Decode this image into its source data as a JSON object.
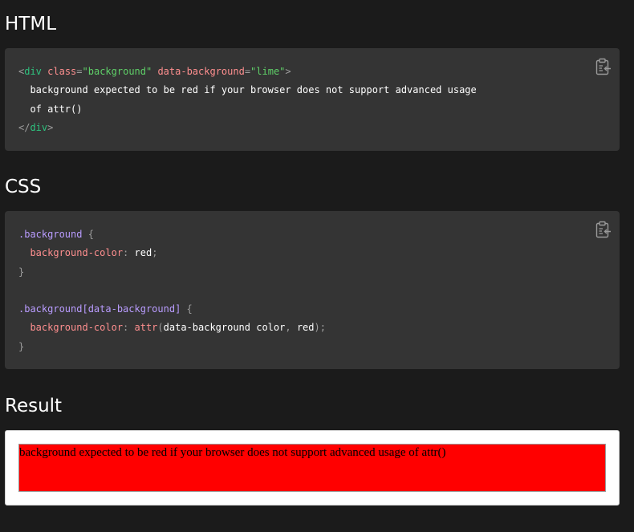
{
  "sections": {
    "html_heading": "HTML",
    "css_heading": "CSS",
    "result_heading": "Result"
  },
  "html_code": {
    "l1_open": "<",
    "l1_tag": "div",
    "l1_attr1": " class",
    "l1_eq1": "=",
    "l1_val1": "\"background\"",
    "l1_attr2": " data-background",
    "l1_eq2": "=",
    "l1_val2": "\"lime\"",
    "l1_close": ">",
    "l2": "  background expected to be red if your browser does not support advanced usage",
    "l3": "  of attr()",
    "l4_open": "</",
    "l4_tag": "div",
    "l4_close": ">"
  },
  "css_code": {
    "r1_sel": ".background",
    "r1_brace": " {",
    "r1_prop": "  background-color",
    "r1_colon": ":",
    "r1_val": " red",
    "r1_semi": ";",
    "r1_end": "}",
    "r2_sel": ".background[data-background]",
    "r2_brace": " {",
    "r2_prop": "  background-color",
    "r2_colon": ":",
    "r2_fn": " attr",
    "r2_paren_open": "(",
    "r2_args": "data-background color",
    "r2_comma": ",",
    "r2_arg2": " red",
    "r2_paren_close": ")",
    "r2_semi": ";",
    "r2_end": "}"
  },
  "result": {
    "text": "background expected to be red if your browser does not support advanced usage of attr()",
    "background_color": "#ff0000"
  },
  "icons": {
    "copy_html": "clipboard-copy-icon",
    "copy_css": "clipboard-copy-icon"
  },
  "colors": {
    "page_bg": "#1b1b1b",
    "code_bg": "#343434",
    "tag": "#2ec27e",
    "attr": "#ff8f8f",
    "string": "#5fd068",
    "selector": "#b99cff"
  }
}
